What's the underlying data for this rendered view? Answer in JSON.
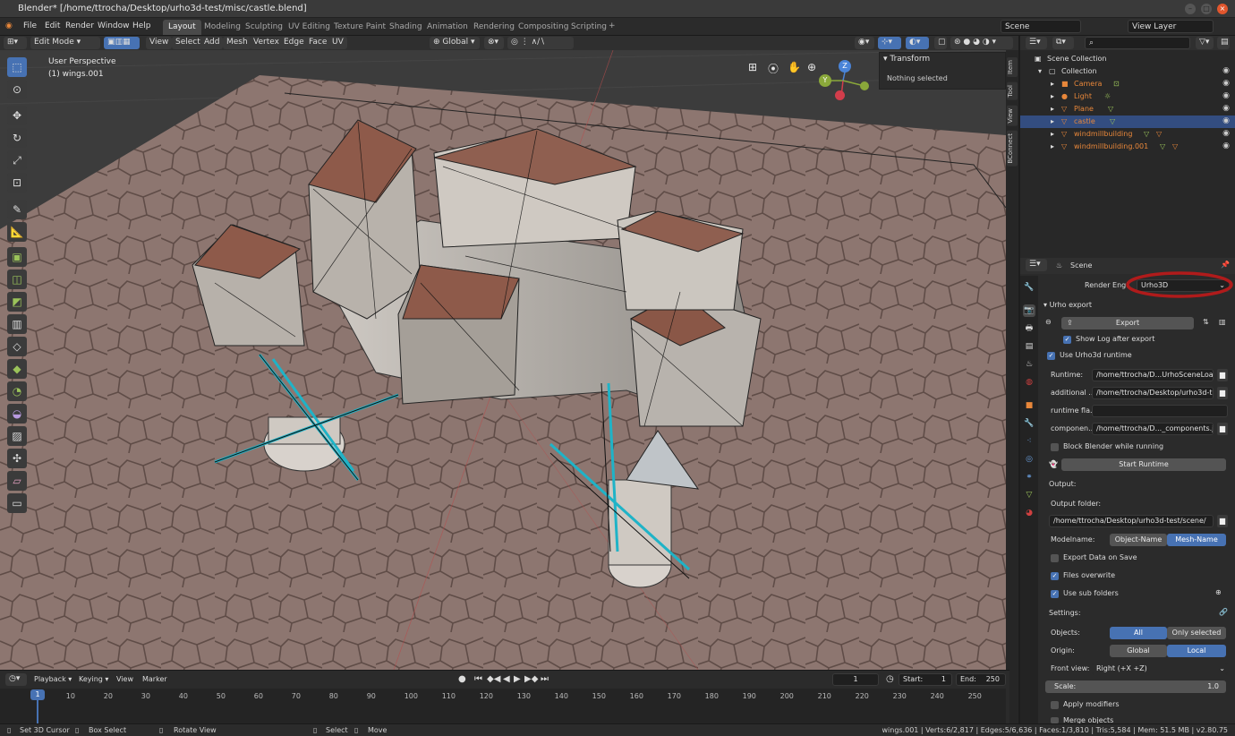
{
  "window": {
    "title": "Blender* [/home/ttrocha/Desktop/urho3d-test/misc/castle.blend]"
  },
  "menus": [
    "File",
    "Edit",
    "Render",
    "Window",
    "Help"
  ],
  "workspaces": [
    "Layout",
    "Modeling",
    "Sculpting",
    "UV Editing",
    "Texture Paint",
    "Shading",
    "Animation",
    "Rendering",
    "Compositing",
    "Scripting"
  ],
  "active_workspace": "Layout",
  "scene_field": "Scene",
  "viewlayer_field": "View Layer",
  "viewport_header": {
    "mode": "Edit Mode",
    "items": [
      "View",
      "Select",
      "Add",
      "Mesh",
      "Vertex",
      "Edge",
      "Face",
      "UV"
    ],
    "orientation": "Global"
  },
  "viewport": {
    "perspective": "User Perspective",
    "object": "(1) wings.001"
  },
  "transform_panel": {
    "title": "Transform",
    "body": "Nothing selected"
  },
  "side_tabs": [
    "Item",
    "Tool",
    "View",
    "BConnect"
  ],
  "gizmo": {
    "x": "X",
    "y": "Y",
    "z": "Z"
  },
  "outliner": {
    "root": "Scene Collection",
    "collection": "Collection",
    "items": [
      {
        "name": "Camera",
        "selected": false
      },
      {
        "name": "Light",
        "selected": false
      },
      {
        "name": "Plane",
        "selected": false
      },
      {
        "name": "castle",
        "selected": true
      },
      {
        "name": "windmillbuilding",
        "selected": false
      },
      {
        "name": "windmillbuilding.001",
        "selected": false
      }
    ]
  },
  "properties": {
    "context": "Scene",
    "render_engine_label": "Render Engi",
    "render_engine": "Urho3D",
    "panel_title": "Urho export",
    "export_button": "Export",
    "show_log": "Show Log after export",
    "use_runtime": "Use Urho3d runtime",
    "runtime_label": "Runtime:",
    "runtime_value": "/home/ttrocha/D...UrhoSceneLoader",
    "additional_label": "additional ...",
    "additional_value": "/home/ttrocha/Desktop/urho3d-tes...",
    "runtime_flags_label": "runtime fla...",
    "runtime_flags_value": "",
    "components_label": "componen...",
    "components_value": "/home/ttrocha/D..._components.json",
    "block_blender": "Block Blender while running",
    "start_runtime": "Start Runtime",
    "output_label": "Output:",
    "output_folder_label": "Output folder:",
    "output_folder_value": "/home/ttrocha/Desktop/urho3d-test/scene/",
    "modelname_label": "Modelname:",
    "modelname_options": [
      "Object-Name",
      "Mesh-Name"
    ],
    "export_on_save": "Export Data on Save",
    "files_overwrite": "Files overwrite",
    "use_subfolders": "Use sub folders",
    "settings_label": "Settings:",
    "objects_label": "Objects:",
    "objects_options": [
      "All",
      "Only selected"
    ],
    "origin_label": "Origin:",
    "origin_options": [
      "Global",
      "Local"
    ],
    "front_view_label": "Front view:",
    "front_view_value": "Right (+X +Z)",
    "scale_label": "Scale:",
    "scale_value": "1.0",
    "apply_modifiers": "Apply modifiers",
    "merge_objects": "Merge objects"
  },
  "timeline": {
    "menus": [
      "Playback",
      "Keying",
      "View",
      "Marker"
    ],
    "current_frame": "1",
    "start_label": "Start:",
    "start": "1",
    "end_label": "End:",
    "end": "250",
    "ticks": [
      "1",
      "10",
      "20",
      "30",
      "40",
      "50",
      "60",
      "70",
      "80",
      "90",
      "100",
      "110",
      "120",
      "130",
      "140",
      "150",
      "160",
      "170",
      "180",
      "190",
      "200",
      "210",
      "220",
      "230",
      "240",
      "250"
    ]
  },
  "status": {
    "items": [
      "Set 3D Cursor",
      "Box Select",
      "Rotate View",
      "Select",
      "Move"
    ],
    "stats": "wings.001 | Verts:6/2,817 | Edges:5/6,636 | Faces:1/3,810 | Tris:5,584 | Mem: 51.5 MB | v2.80.75"
  },
  "colors": {
    "accent": "#4772b3",
    "selected_row": "#334d80",
    "object_orange": "#e8873a",
    "annotation_red": "#b01b1b"
  }
}
